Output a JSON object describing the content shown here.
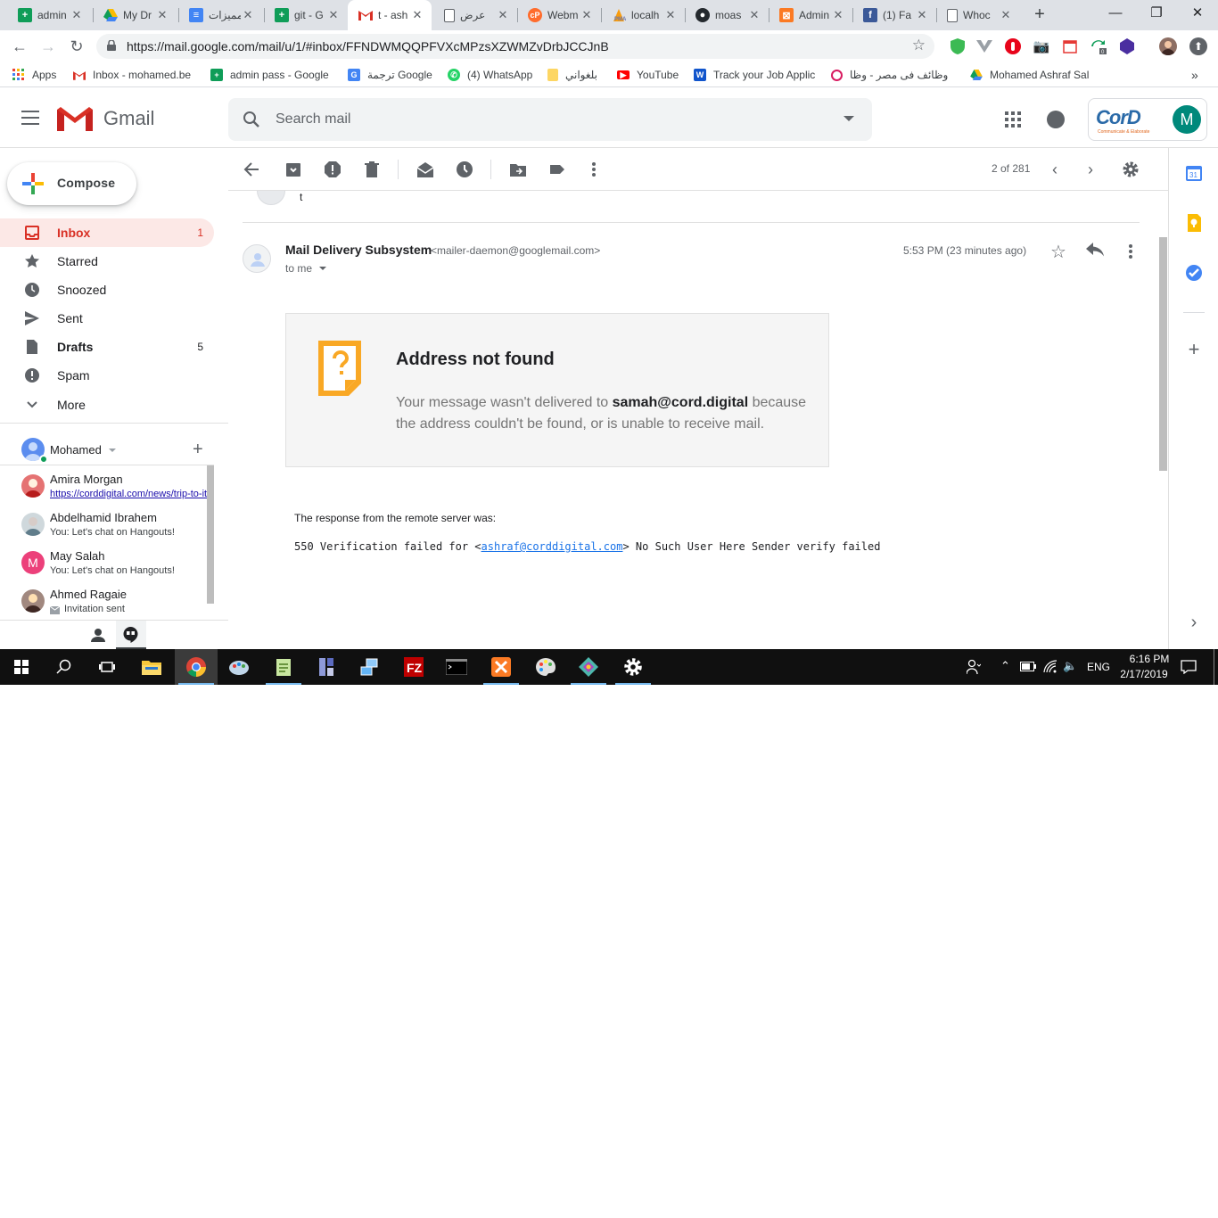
{
  "browser": {
    "tabs": [
      {
        "title": "admin",
        "favicon": "green-sheets"
      },
      {
        "title": "My Dr",
        "favicon": "drive"
      },
      {
        "title": "مميزات",
        "favicon": "blue-docs"
      },
      {
        "title": "git - G",
        "favicon": "green-sheets"
      },
      {
        "title": "t - ash",
        "favicon": "gmail"
      },
      {
        "title": "عرض",
        "favicon": "doc-blank"
      },
      {
        "title": "Webm",
        "favicon": "cpanel"
      },
      {
        "title": "localh",
        "favicon": "phpmyadmin"
      },
      {
        "title": "moas",
        "favicon": "github"
      },
      {
        "title": "Admin",
        "favicon": "xampp"
      },
      {
        "title": "(1) Fa",
        "favicon": "facebook"
      },
      {
        "title": "Whoc",
        "favicon": "doc-blank"
      }
    ],
    "active_tab_index": 4,
    "url": "https://mail.google.com/mail/u/1/#inbox/FFNDWMQQPFVXcMPzsXZWMZvDrbJCCJnB",
    "extension_badge": "0",
    "bookmarks": [
      {
        "label": "Apps"
      },
      {
        "label": "Inbox - mohamed.be"
      },
      {
        "label": "admin pass - Google"
      },
      {
        "label": "ترجمة Google"
      },
      {
        "label": "(4) WhatsApp"
      },
      {
        "label": "بلغواني"
      },
      {
        "label": "YouTube"
      },
      {
        "label": "Track your Job Applic"
      },
      {
        "label": "وظائف فى مصر - وظا"
      },
      {
        "label": "Mohamed Ashraf Sal"
      }
    ]
  },
  "gmail": {
    "product_name": "Gmail",
    "search_placeholder": "Search mail",
    "account_logo_text": "CorD",
    "account_logo_sub": "Communicate & Elaborate",
    "account_initial": "M",
    "compose_label": "Compose",
    "nav": [
      {
        "label": "Inbox",
        "count": "1"
      },
      {
        "label": "Starred",
        "count": ""
      },
      {
        "label": "Snoozed",
        "count": ""
      },
      {
        "label": "Sent",
        "count": ""
      },
      {
        "label": "Drafts",
        "count": "5"
      },
      {
        "label": "Spam",
        "count": ""
      },
      {
        "label": "More",
        "count": ""
      }
    ],
    "hangouts": {
      "user_name": "Mohamed",
      "contacts": [
        {
          "name": "Amira Morgan",
          "message": "https://corddigital.com/news/trip-to-it"
        },
        {
          "name": "Abdelhamid Ibrahem",
          "message": "You: Let's chat on Hangouts!"
        },
        {
          "name": "May Salah",
          "message": "You: Let's chat on Hangouts!",
          "initial": "M"
        },
        {
          "name": "Ahmed Ragaie",
          "message": "Invitation sent"
        }
      ]
    },
    "toolbar": {
      "pager": "2 of 281"
    },
    "previous_message_snippet": "t",
    "message": {
      "sender_name": "Mail Delivery Subsystem",
      "sender_email": "<mailer-daemon@googlemail.com>",
      "to": "to me",
      "time": "5:53 PM (23 minutes ago)",
      "bounce_title": "Address not found",
      "bounce_text_before": "Your message wasn't delivered to ",
      "bounce_address": "samah@cord.digital",
      "bounce_text_after": " because the address couldn't be found, or is unable to receive mail.",
      "response_label": "The response from the remote server was:",
      "response_prefix": "550 Verification failed for <",
      "response_email": "ashraf@corddigital.com",
      "response_suffix": "> No Such User Here Sender verify failed"
    }
  },
  "taskbar": {
    "language": "ENG",
    "time": "6:16 PM",
    "date": "2/17/2019"
  },
  "colors": {
    "gmail_red": "#d93025",
    "inbox_highlight": "#fce8e6",
    "link_blue": "#1a73e8",
    "bounce_orange": "#f9a825"
  }
}
